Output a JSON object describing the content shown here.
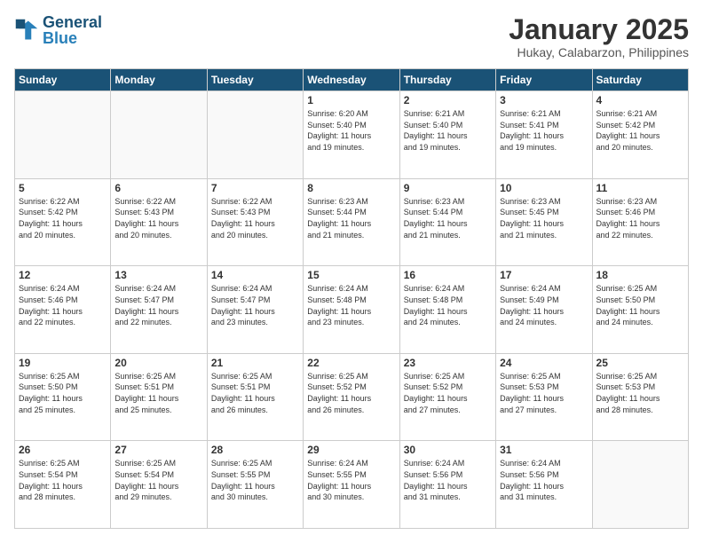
{
  "logo": {
    "line1": "General",
    "line2": "Blue"
  },
  "header": {
    "title": "January 2025",
    "subtitle": "Hukay, Calabarzon, Philippines"
  },
  "weekdays": [
    "Sunday",
    "Monday",
    "Tuesday",
    "Wednesday",
    "Thursday",
    "Friday",
    "Saturday"
  ],
  "weeks": [
    [
      {
        "day": "",
        "info": ""
      },
      {
        "day": "",
        "info": ""
      },
      {
        "day": "",
        "info": ""
      },
      {
        "day": "1",
        "info": "Sunrise: 6:20 AM\nSunset: 5:40 PM\nDaylight: 11 hours\nand 19 minutes."
      },
      {
        "day": "2",
        "info": "Sunrise: 6:21 AM\nSunset: 5:40 PM\nDaylight: 11 hours\nand 19 minutes."
      },
      {
        "day": "3",
        "info": "Sunrise: 6:21 AM\nSunset: 5:41 PM\nDaylight: 11 hours\nand 19 minutes."
      },
      {
        "day": "4",
        "info": "Sunrise: 6:21 AM\nSunset: 5:42 PM\nDaylight: 11 hours\nand 20 minutes."
      }
    ],
    [
      {
        "day": "5",
        "info": "Sunrise: 6:22 AM\nSunset: 5:42 PM\nDaylight: 11 hours\nand 20 minutes."
      },
      {
        "day": "6",
        "info": "Sunrise: 6:22 AM\nSunset: 5:43 PM\nDaylight: 11 hours\nand 20 minutes."
      },
      {
        "day": "7",
        "info": "Sunrise: 6:22 AM\nSunset: 5:43 PM\nDaylight: 11 hours\nand 20 minutes."
      },
      {
        "day": "8",
        "info": "Sunrise: 6:23 AM\nSunset: 5:44 PM\nDaylight: 11 hours\nand 21 minutes."
      },
      {
        "day": "9",
        "info": "Sunrise: 6:23 AM\nSunset: 5:44 PM\nDaylight: 11 hours\nand 21 minutes."
      },
      {
        "day": "10",
        "info": "Sunrise: 6:23 AM\nSunset: 5:45 PM\nDaylight: 11 hours\nand 21 minutes."
      },
      {
        "day": "11",
        "info": "Sunrise: 6:23 AM\nSunset: 5:46 PM\nDaylight: 11 hours\nand 22 minutes."
      }
    ],
    [
      {
        "day": "12",
        "info": "Sunrise: 6:24 AM\nSunset: 5:46 PM\nDaylight: 11 hours\nand 22 minutes."
      },
      {
        "day": "13",
        "info": "Sunrise: 6:24 AM\nSunset: 5:47 PM\nDaylight: 11 hours\nand 22 minutes."
      },
      {
        "day": "14",
        "info": "Sunrise: 6:24 AM\nSunset: 5:47 PM\nDaylight: 11 hours\nand 23 minutes."
      },
      {
        "day": "15",
        "info": "Sunrise: 6:24 AM\nSunset: 5:48 PM\nDaylight: 11 hours\nand 23 minutes."
      },
      {
        "day": "16",
        "info": "Sunrise: 6:24 AM\nSunset: 5:48 PM\nDaylight: 11 hours\nand 24 minutes."
      },
      {
        "day": "17",
        "info": "Sunrise: 6:24 AM\nSunset: 5:49 PM\nDaylight: 11 hours\nand 24 minutes."
      },
      {
        "day": "18",
        "info": "Sunrise: 6:25 AM\nSunset: 5:50 PM\nDaylight: 11 hours\nand 24 minutes."
      }
    ],
    [
      {
        "day": "19",
        "info": "Sunrise: 6:25 AM\nSunset: 5:50 PM\nDaylight: 11 hours\nand 25 minutes."
      },
      {
        "day": "20",
        "info": "Sunrise: 6:25 AM\nSunset: 5:51 PM\nDaylight: 11 hours\nand 25 minutes."
      },
      {
        "day": "21",
        "info": "Sunrise: 6:25 AM\nSunset: 5:51 PM\nDaylight: 11 hours\nand 26 minutes."
      },
      {
        "day": "22",
        "info": "Sunrise: 6:25 AM\nSunset: 5:52 PM\nDaylight: 11 hours\nand 26 minutes."
      },
      {
        "day": "23",
        "info": "Sunrise: 6:25 AM\nSunset: 5:52 PM\nDaylight: 11 hours\nand 27 minutes."
      },
      {
        "day": "24",
        "info": "Sunrise: 6:25 AM\nSunset: 5:53 PM\nDaylight: 11 hours\nand 27 minutes."
      },
      {
        "day": "25",
        "info": "Sunrise: 6:25 AM\nSunset: 5:53 PM\nDaylight: 11 hours\nand 28 minutes."
      }
    ],
    [
      {
        "day": "26",
        "info": "Sunrise: 6:25 AM\nSunset: 5:54 PM\nDaylight: 11 hours\nand 28 minutes."
      },
      {
        "day": "27",
        "info": "Sunrise: 6:25 AM\nSunset: 5:54 PM\nDaylight: 11 hours\nand 29 minutes."
      },
      {
        "day": "28",
        "info": "Sunrise: 6:25 AM\nSunset: 5:55 PM\nDaylight: 11 hours\nand 30 minutes."
      },
      {
        "day": "29",
        "info": "Sunrise: 6:24 AM\nSunset: 5:55 PM\nDaylight: 11 hours\nand 30 minutes."
      },
      {
        "day": "30",
        "info": "Sunrise: 6:24 AM\nSunset: 5:56 PM\nDaylight: 11 hours\nand 31 minutes."
      },
      {
        "day": "31",
        "info": "Sunrise: 6:24 AM\nSunset: 5:56 PM\nDaylight: 11 hours\nand 31 minutes."
      },
      {
        "day": "",
        "info": ""
      }
    ]
  ]
}
